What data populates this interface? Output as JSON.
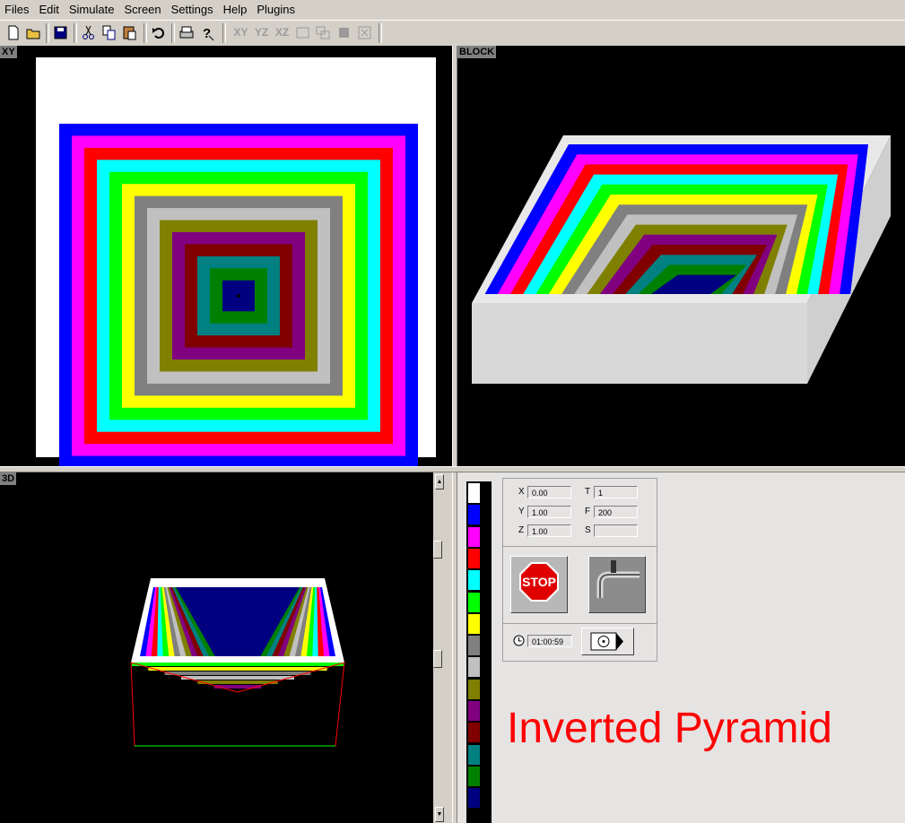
{
  "menu": [
    "Files",
    "Edit",
    "Simulate",
    "Screen",
    "Settings",
    "Help",
    "Plugins"
  ],
  "toolbar": {
    "new": "new-file-icon",
    "open": "open-folder-icon",
    "save": "save-disk-icon",
    "cut": "cut-icon",
    "copy": "copy-icon",
    "paste": "paste-icon",
    "undo": "undo-icon",
    "print": "print-icon",
    "help": "help-icon",
    "view_xy": "XY",
    "view_yz": "YZ",
    "view_xz": "XZ"
  },
  "panes": {
    "xy": "XY",
    "block": "BLOCK",
    "threed": "3D"
  },
  "coords": {
    "x_label": "X",
    "x_value": "0.00",
    "y_label": "Y",
    "y_value": "1.00",
    "z_label": "Z",
    "z_value": "1.00",
    "t_label": "T",
    "t_value": "1",
    "f_label": "F",
    "f_value": "200",
    "s_label": "S",
    "s_value": ""
  },
  "stop_label": "STOP",
  "timer": "01:00:59",
  "caption": "Inverted Pyramid",
  "palette": [
    "#ffffff",
    "#0000ff",
    "#ff00ff",
    "#ff0000",
    "#00ffff",
    "#00ff00",
    "#ffff00",
    "#808080",
    "#c0c0c0",
    "#808000",
    "#800080",
    "#800000",
    "#008080",
    "#008000",
    "#000080"
  ],
  "ring_colors": [
    "#0000ff",
    "#ff00ff",
    "#ff0000",
    "#00ffff",
    "#00ff00",
    "#ffff00",
    "#808080",
    "#c0c0c0",
    "#808000",
    "#800080",
    "#800000",
    "#008080",
    "#008000",
    "#000080"
  ]
}
